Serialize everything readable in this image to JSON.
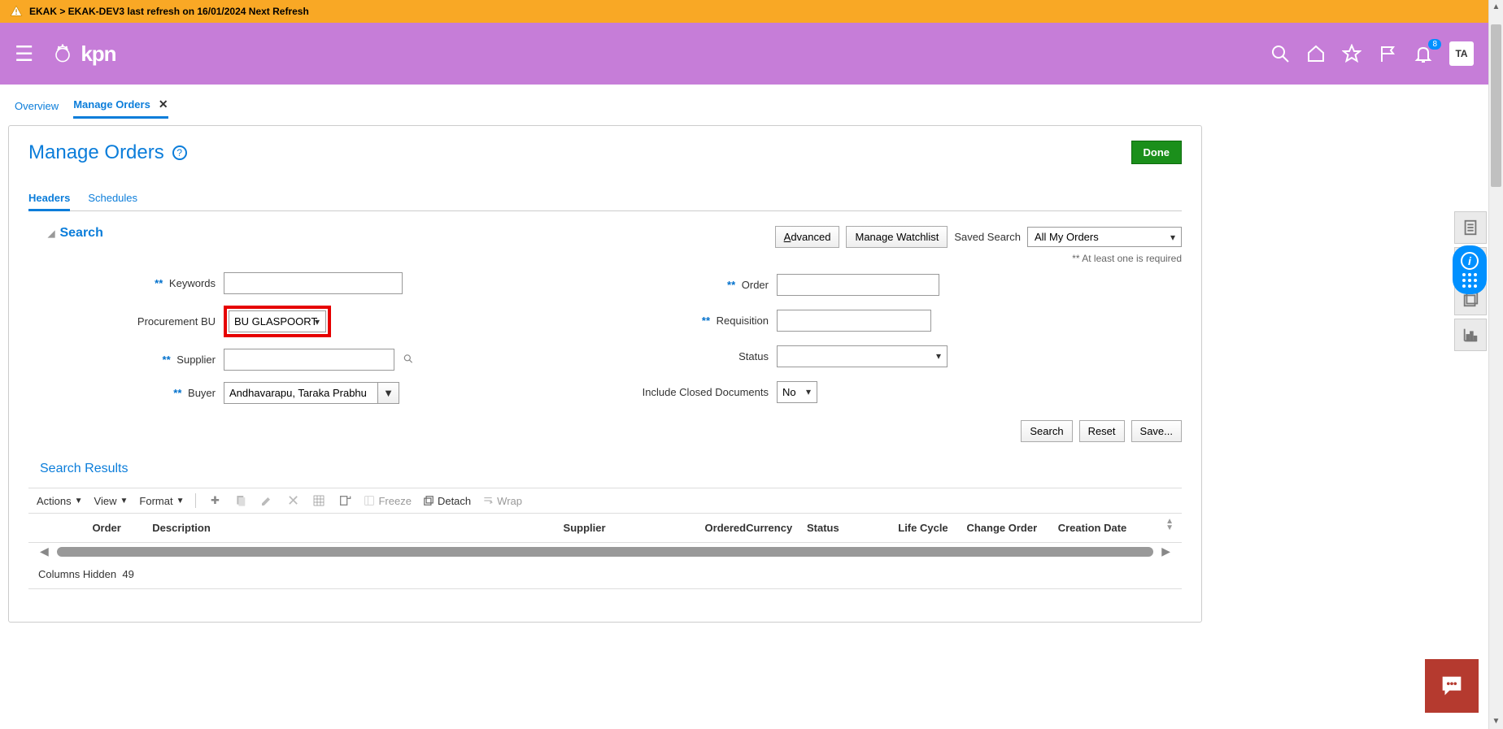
{
  "notification": "EKAK > EKAK-DEV3 last refresh on 16/01/2024 Next Refresh",
  "header": {
    "logo_text": "kpn",
    "badge_count": "8",
    "avatar": "TA"
  },
  "tabs": {
    "overview": "Overview",
    "manage_orders": "Manage Orders"
  },
  "page": {
    "title": "Manage Orders",
    "done": "Done"
  },
  "subtabs": {
    "headers": "Headers",
    "schedules": "Schedules"
  },
  "search": {
    "title": "Search",
    "advanced": "Advanced",
    "advanced_key": "A",
    "manage_watchlist": "Manage Watchlist",
    "saved_search_label": "Saved Search",
    "saved_search_value": "All My Orders",
    "required_note": "** At least one is required",
    "fields": {
      "keywords": "Keywords",
      "procurement_bu": "Procurement BU",
      "procurement_bu_value": "BU GLASPOORT",
      "supplier": "Supplier",
      "buyer": "Buyer",
      "buyer_value": "Andhavarapu, Taraka Prabhu",
      "order": "Order",
      "requisition": "Requisition",
      "status": "Status",
      "include_closed": "Include Closed Documents",
      "include_closed_value": "No"
    },
    "buttons": {
      "search": "Search",
      "reset": "Reset",
      "save": "Save..."
    }
  },
  "results": {
    "title": "Search Results",
    "toolbar": {
      "actions": "Actions",
      "view": "View",
      "format": "Format",
      "freeze": "Freeze",
      "detach": "Detach",
      "wrap": "Wrap"
    },
    "columns": {
      "order": "Order",
      "description": "Description",
      "supplier": "Supplier",
      "ordered": "Ordered",
      "currency": "Currency",
      "status": "Status",
      "life_cycle": "Life Cycle",
      "change_order": "Change Order",
      "creation_date": "Creation Date"
    },
    "columns_hidden_label": "Columns Hidden",
    "columns_hidden_count": "49"
  }
}
